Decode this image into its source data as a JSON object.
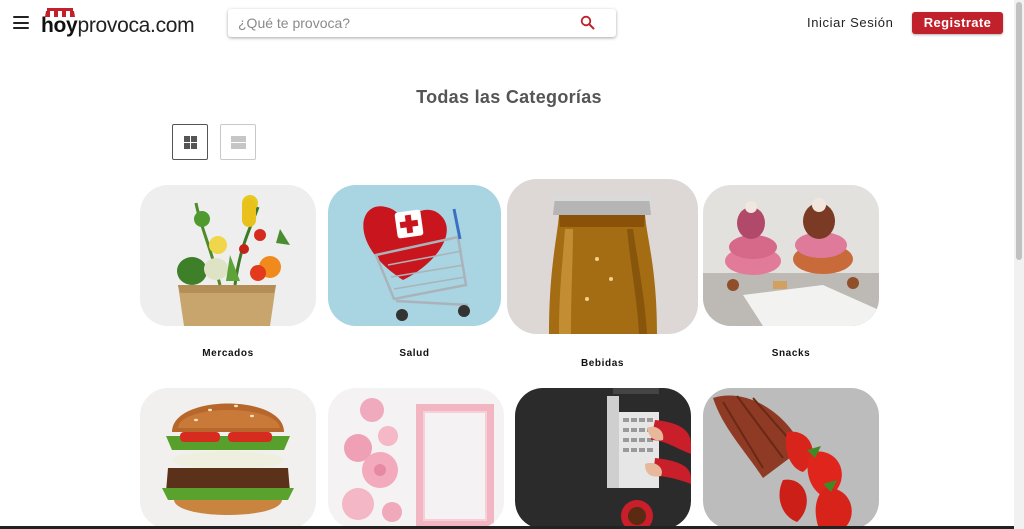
{
  "header": {
    "logo": {
      "hoy": "hoy",
      "rest": "provoca.com"
    },
    "search": {
      "placeholder": "¿Qué te provoca?"
    },
    "login_label": "Iniciar Sesión",
    "register_label": "Registrate"
  },
  "main": {
    "title": "Todas las Categorías",
    "view_modes": [
      "grid",
      "list"
    ],
    "active_view": "grid",
    "categories": [
      {
        "label": "Mercados"
      },
      {
        "label": "Salud"
      },
      {
        "label": "Bebidas"
      },
      {
        "label": "Snacks"
      },
      {
        "label": ""
      },
      {
        "label": ""
      },
      {
        "label": ""
      },
      {
        "label": ""
      }
    ]
  },
  "colors": {
    "brand_red": "#c0212b",
    "title_gray": "#555555"
  },
  "icons": [
    "menu-icon",
    "search-icon",
    "grid-view-icon",
    "list-view-icon",
    "store-awning-icon"
  ]
}
